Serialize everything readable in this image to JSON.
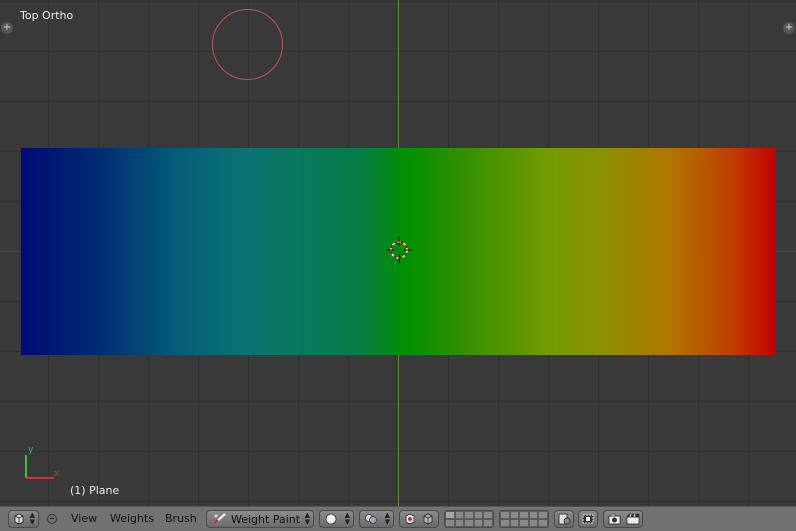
{
  "viewport": {
    "view_label": "Top Ortho",
    "object_label": "(1) Plane",
    "corner_plus": "+",
    "gizmo_y": "y",
    "gizmo_x": "x"
  },
  "header": {
    "menus": [
      "View",
      "Weights",
      "Brush"
    ],
    "mode_label": "Weight Paint",
    "editor_icon": "cube-icon",
    "shading_icon": "solid-sphere-icon",
    "pivot_icon": "pivot-icon"
  },
  "colors": {
    "background": "#393939",
    "header": "#727272",
    "y_axis": "#5f8a3c",
    "x_axis": "#7a4444",
    "lamp": "#b85858"
  }
}
